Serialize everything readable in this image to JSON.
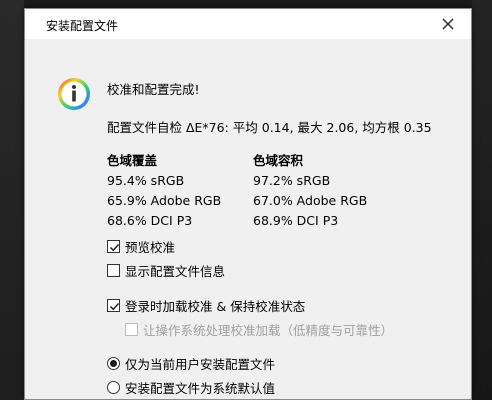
{
  "dialog": {
    "title": "安装配置文件"
  },
  "message": {
    "headline": "校准和配置完成!",
    "summary": "配置文件自检 ΔE*76: 平均 0.14, 最大 2.06, 均方根 0.35"
  },
  "gamut_coverage": {
    "heading": "色域覆盖",
    "rows": [
      "95.4% sRGB",
      "65.9% Adobe RGB",
      "68.6% DCI P3"
    ]
  },
  "gamut_volume": {
    "heading": "色域容积",
    "rows": [
      "97.2% sRGB",
      "67.0% Adobe RGB",
      "68.9% DCI P3"
    ]
  },
  "options": {
    "preview_calibration": {
      "label": "预览校准",
      "checked": true
    },
    "show_profile_info": {
      "label": "显示配置文件信息",
      "checked": false
    },
    "load_on_login": {
      "label": "登录时加载校准 & 保持校准状态",
      "checked": true
    },
    "os_handle_loading": {
      "label": "让操作系统处理校准加载（低精度与可靠性）",
      "checked": false,
      "disabled": true
    }
  },
  "install_scope": {
    "current_user": {
      "label": "仅为当前用户安装配置文件",
      "selected": true
    },
    "system_default": {
      "label": "安装配置文件为系统默认值",
      "selected": false
    }
  },
  "icons": {
    "close": "close-icon",
    "info": "info-icon",
    "check": "checkmark-icon"
  }
}
